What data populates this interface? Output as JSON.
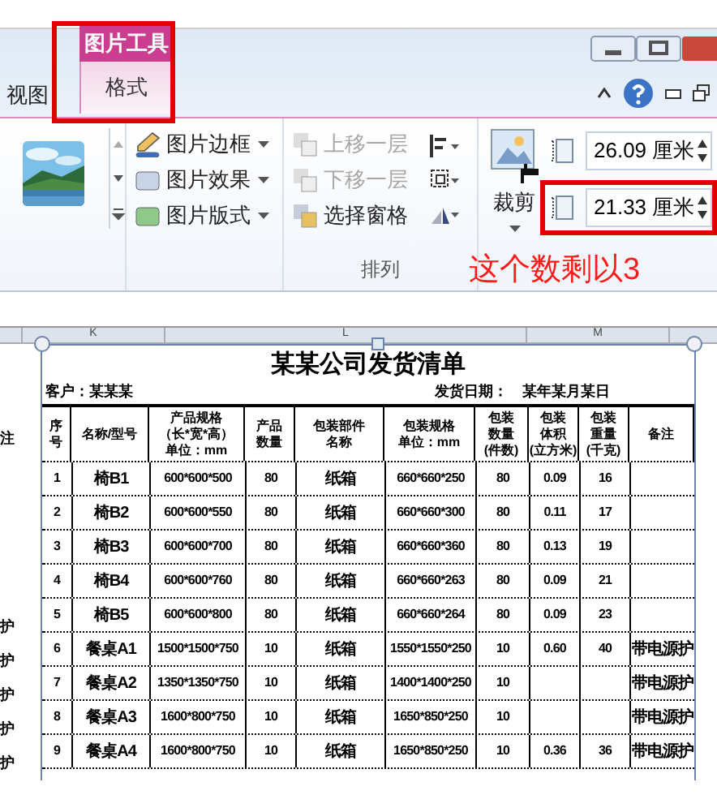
{
  "ribbon": {
    "tabs": [
      {
        "label": "视图",
        "selected": false
      }
    ],
    "context_tab": {
      "group": "图片工具",
      "tab": "格式",
      "selected": true
    },
    "picture_commands": [
      "图片边框",
      "图片效果",
      "图片版式"
    ],
    "arrange_commands": [
      {
        "label": "上移一层",
        "disabled": true
      },
      {
        "label": "下移一层",
        "disabled": true
      },
      {
        "label": "选择窗格",
        "disabled": false
      }
    ],
    "arrange_group": "排列",
    "crop": "裁剪",
    "height": {
      "value": "26.09 厘米"
    },
    "width": {
      "value": "21.33 厘米"
    },
    "annotation": "这个数剩以3"
  },
  "column_bar": {
    "letters": [
      "K",
      "L",
      "M"
    ]
  },
  "sheet": {
    "left_fragments": [
      "注",
      "护",
      "护",
      "护",
      "护",
      "护"
    ],
    "title": "某某公司发货清单",
    "customer": "客户：某某某",
    "date": "发货日期：　某年某月某日",
    "headers": [
      [
        "序",
        "号"
      ],
      [
        "名称/型号"
      ],
      [
        "产品规格",
        "（长*宽*高）",
        "单位：mm"
      ],
      [
        "产品",
        "数量"
      ],
      [
        "包装部件",
        "名称"
      ],
      [
        "包装规格",
        "单位：mm"
      ],
      [
        "包装",
        "数量",
        "(件数)"
      ],
      [
        "包装",
        "体积",
        "(立方米)"
      ],
      [
        "包装",
        "重量",
        "(千克)"
      ],
      [
        "备注"
      ]
    ],
    "rows": [
      [
        "1",
        "椅B1",
        "600*600*500",
        "80",
        "纸箱",
        "660*660*250",
        "80",
        "0.09",
        "16",
        null
      ],
      [
        "2",
        "椅B2",
        "600*600*550",
        "80",
        "纸箱",
        "660*660*300",
        "80",
        "0.11",
        "17",
        null
      ],
      [
        "3",
        "椅B3",
        "600*600*700",
        "80",
        "纸箱",
        "660*660*360",
        "80",
        "0.13",
        "19",
        null
      ],
      [
        "4",
        "椅B4",
        "600*600*760",
        "80",
        "纸箱",
        "660*660*263",
        "80",
        "0.09",
        "21",
        null
      ],
      [
        "5",
        "椅B5",
        "600*600*800",
        "80",
        "纸箱",
        "660*660*264",
        "80",
        "0.09",
        "23",
        null
      ],
      [
        "6",
        "餐桌A1",
        "1500*1500*750",
        "10",
        "纸箱",
        "1550*1550*250",
        "10",
        "0.60",
        "40",
        "带电源护"
      ],
      [
        "7",
        "餐桌A2",
        "1350*1350*750",
        "10",
        "纸箱",
        "1400*1400*250",
        "10",
        null,
        null,
        "带电源护"
      ],
      [
        "8",
        "餐桌A3",
        "1600*800*750",
        "10",
        "纸箱",
        "1650*850*250",
        "10",
        null,
        null,
        "带电源护"
      ],
      [
        "9",
        "餐桌A4",
        "1600*800*750",
        "10",
        "纸箱",
        "1650*850*250",
        "10",
        "0.36",
        "36",
        "带电源护"
      ]
    ]
  }
}
